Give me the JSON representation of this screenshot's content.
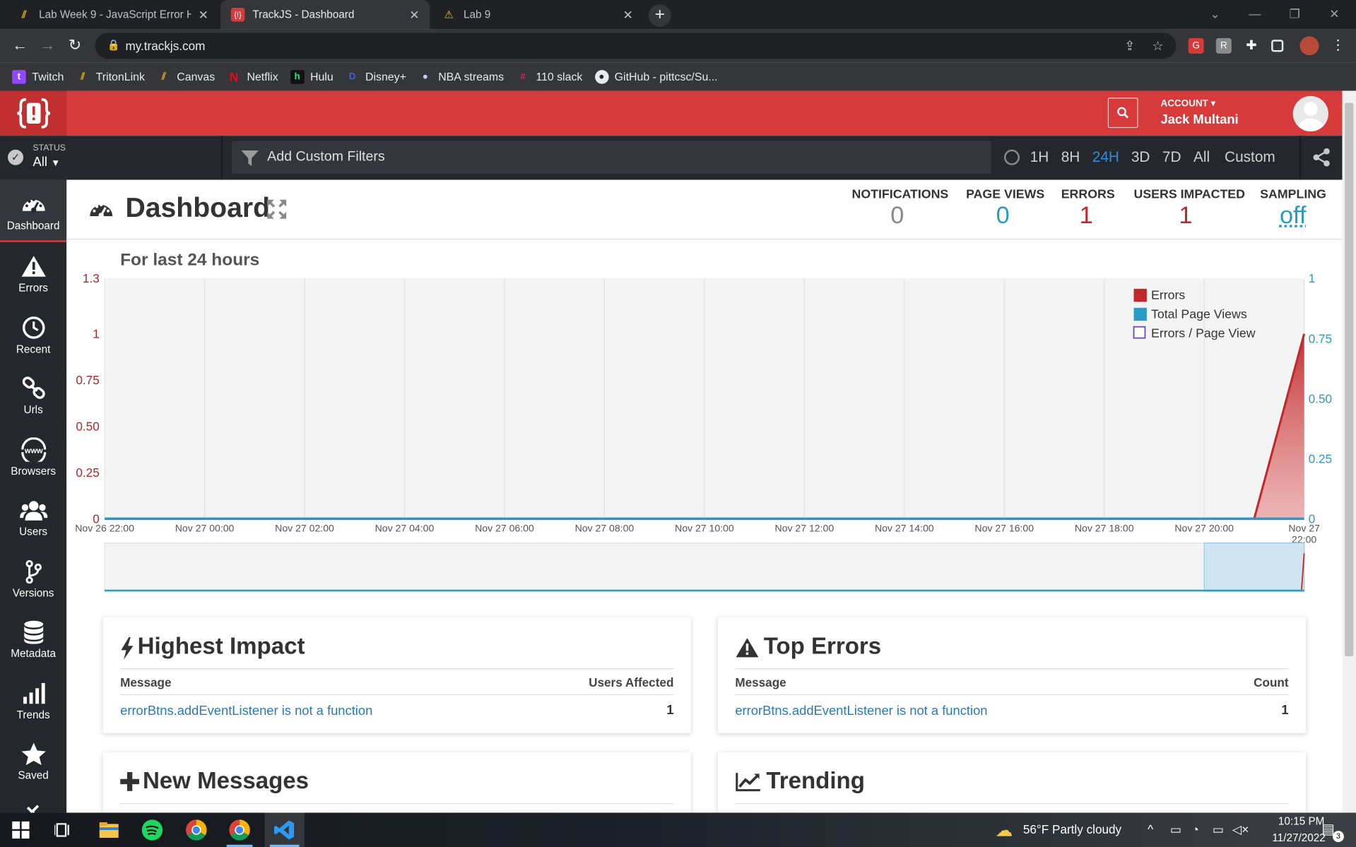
{
  "browser": {
    "tabs": [
      {
        "title": "Lab Week 9 - JavaScript Error Han",
        "active": false
      },
      {
        "title": "TrackJS - Dashboard",
        "active": true
      },
      {
        "title": "Lab 9",
        "active": false
      }
    ],
    "url": "my.trackjs.com",
    "bookmarks": [
      "Twitch",
      "TritonLink",
      "Canvas",
      "Netflix",
      "Hulu",
      "Disney+",
      "NBA streams",
      "110 slack",
      "GitHub - pittcsc/Su..."
    ]
  },
  "header": {
    "account_label": "ACCOUNT",
    "user_name": "Jack Multani"
  },
  "filters": {
    "status_label": "STATUS",
    "status_value": "All",
    "custom_filter_placeholder": "Add Custom Filters",
    "time_ranges": [
      "1H",
      "8H",
      "24H",
      "3D",
      "7D",
      "All",
      "Custom"
    ],
    "active_range": "24H"
  },
  "sidebar": {
    "items": [
      "Dashboard",
      "Errors",
      "Recent",
      "Urls",
      "Browsers",
      "Users",
      "Versions",
      "Metadata",
      "Trends",
      "Saved"
    ],
    "active": "Dashboard"
  },
  "dashboard": {
    "title": "Dashboard",
    "metrics": [
      {
        "label": "NOTIFICATIONS",
        "value": "0",
        "color": "#888888"
      },
      {
        "label": "PAGE VIEWS",
        "value": "0",
        "color": "#2a9bc4"
      },
      {
        "label": "ERRORS",
        "value": "1",
        "color": "#c0282b"
      },
      {
        "label": "USERS IMPACTED",
        "value": "1",
        "color": "#c0282b"
      },
      {
        "label": "SAMPLING",
        "value": "off",
        "color": "#2a9bc4"
      }
    ]
  },
  "chart_data": {
    "type": "area",
    "subtitle": "For last 24 hours",
    "x": [
      "Nov 26 22:00",
      "Nov 27 00:00",
      "Nov 27 02:00",
      "Nov 27 04:00",
      "Nov 27 06:00",
      "Nov 27 08:00",
      "Nov 27 10:00",
      "Nov 27 12:00",
      "Nov 27 14:00",
      "Nov 27 16:00",
      "Nov 27 18:00",
      "Nov 27 20:00",
      "Nov 27 22:00"
    ],
    "y_left_ticks": [
      "0",
      "0.25",
      "0.50",
      "0.75",
      "1",
      "1.3"
    ],
    "y_right_ticks": [
      "0",
      "0.25",
      "0.50",
      "0.75",
      "1"
    ],
    "y_left_range": [
      0,
      1.3
    ],
    "y_right_range": [
      0,
      1
    ],
    "series": [
      {
        "name": "Errors",
        "color": "#c0282b",
        "points": [
          [
            "Nov 27 21:00",
            0
          ],
          [
            "Nov 27 22:00",
            1
          ]
        ]
      },
      {
        "name": "Total Page Views",
        "color": "#2a9bc4",
        "points": [
          [
            "Nov 26 22:00",
            0
          ],
          [
            "Nov 27 22:00",
            0
          ]
        ]
      },
      {
        "name": "Errors / Page View",
        "color": "#6b4bb5",
        "points": []
      }
    ],
    "legend_position": "top-right",
    "grid": true
  },
  "panels": {
    "highest_impact": {
      "title": "Highest Impact",
      "col1": "Message",
      "col2": "Users Affected",
      "rows": [
        {
          "message": "errorBtns.addEventListener is not a function",
          "value": "1"
        }
      ]
    },
    "top_errors": {
      "title": "Top Errors",
      "col1": "Message",
      "col2": "Count",
      "rows": [
        {
          "message": "errorBtns.addEventListener is not a function",
          "value": "1"
        }
      ]
    },
    "new_messages": {
      "title": "New Messages"
    },
    "trending": {
      "title": "Trending"
    }
  },
  "taskbar": {
    "weather": "56°F  Partly cloudy",
    "time": "10:15 PM",
    "date": "11/27/2022",
    "notif_count": "3"
  }
}
